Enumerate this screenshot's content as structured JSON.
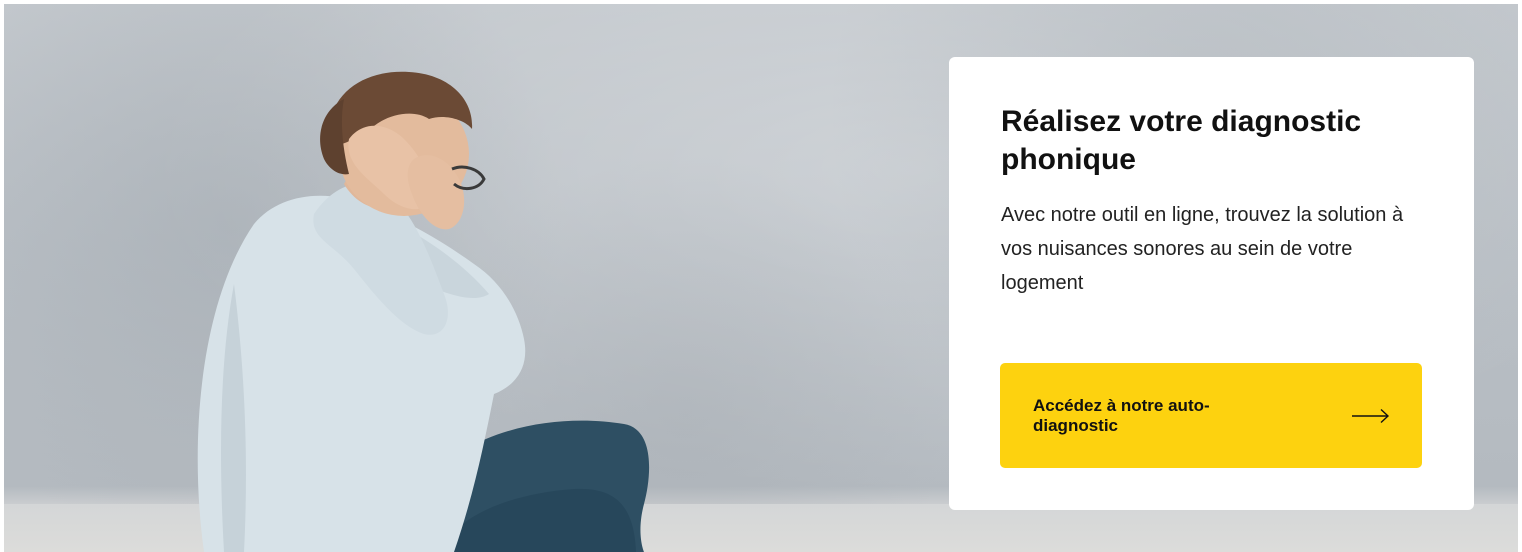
{
  "hero": {
    "image_alt": "Homme se bouchant les oreilles assis contre un mur"
  },
  "card": {
    "title": "Réalisez votre diagnostic phonique",
    "text": "Avec notre outil en ligne, trouvez la solution à vos nuisances sonores au sein de votre logement",
    "cta": {
      "label": "Accédez à notre auto-diagnostic",
      "icon": "arrow-right-icon"
    }
  },
  "colors": {
    "cta_background": "#fdd20f",
    "card_background": "#ffffff",
    "title": "#111111"
  }
}
